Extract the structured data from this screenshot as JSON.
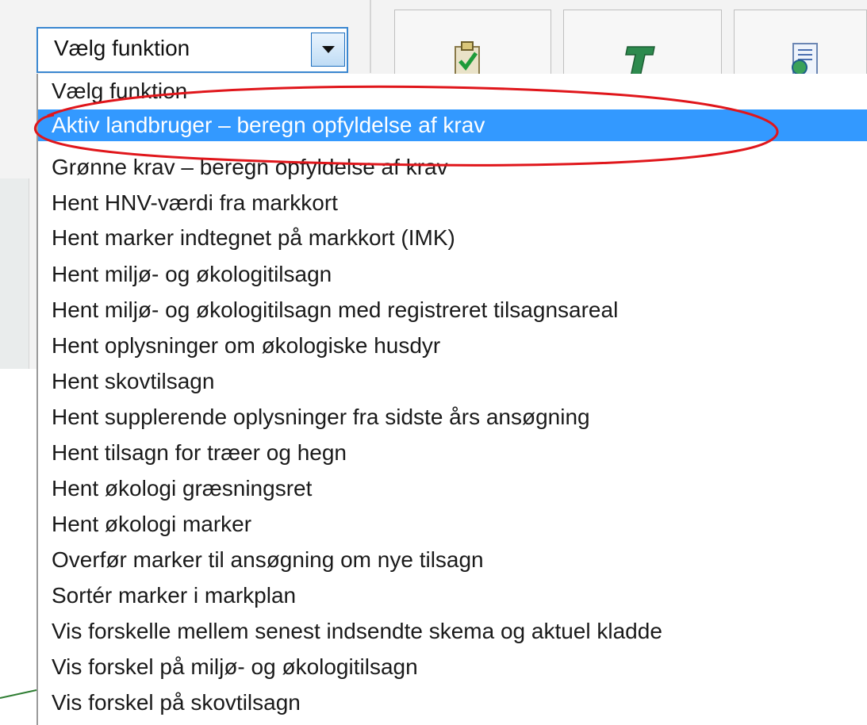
{
  "select": {
    "value": "Vælg funktion"
  },
  "toolbar": {
    "buttons": [
      {
        "icon": "clipboard-check-icon"
      },
      {
        "icon": "green-t-icon"
      },
      {
        "icon": "document-globe-icon"
      }
    ]
  },
  "dropdown": {
    "options": [
      {
        "label": "Vælg funktion"
      },
      {
        "label": "Aktiv landbruger – beregn opfyldelse af krav",
        "selected": true
      },
      {
        "label": "Grønne krav – beregn opfyldelse af krav"
      },
      {
        "label": "Hent HNV-værdi fra markkort"
      },
      {
        "label": "Hent marker indtegnet på markkort (IMK)"
      },
      {
        "label": "Hent miljø- og økologitilsagn"
      },
      {
        "label": "Hent miljø- og økologitilsagn med registreret tilsagnsareal"
      },
      {
        "label": "Hent oplysninger om økologiske husdyr"
      },
      {
        "label": "Hent skovtilsagn"
      },
      {
        "label": "Hent supplerende oplysninger fra sidste års ansøgning"
      },
      {
        "label": "Hent tilsagn for træer og hegn"
      },
      {
        "label": "Hent økologi græsningsret"
      },
      {
        "label": "Hent økologi marker"
      },
      {
        "label": "Overfør marker til ansøgning om nye tilsagn"
      },
      {
        "label": "Sortér marker i markplan"
      },
      {
        "label": "Vis forskelle mellem senest indsendte skema og aktuel kladde"
      },
      {
        "label": "Vis forskel på miljø- og økologitilsagn"
      },
      {
        "label": "Vis forskel på skovtilsagn"
      }
    ]
  },
  "colors": {
    "selected_bg": "#3399ff",
    "annotation_red": "#e0161b",
    "select_border": "#3a87d0"
  }
}
